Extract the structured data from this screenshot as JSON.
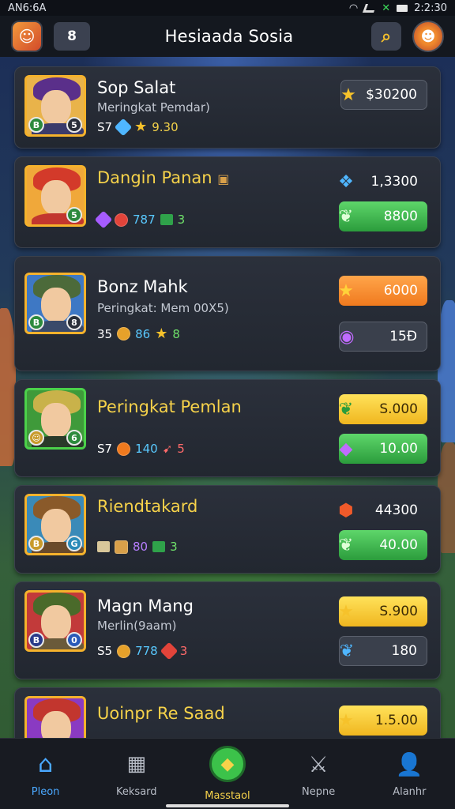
{
  "status": {
    "left": "AN6:6A",
    "time": "2:2:30"
  },
  "header": {
    "box_label": "8",
    "title": "Hesiaada Sosia"
  },
  "rows": [
    {
      "name": "Sop Salat",
      "subtitle": "Meringkat Pemdar)",
      "stats": [
        "S7",
        "9.30"
      ],
      "price_top": "$30200"
    },
    {
      "name": "Dangin Panan",
      "subtitle": "",
      "stats": [
        "787",
        "3"
      ],
      "price_top": "1,3300",
      "price_mid": "8800"
    },
    {
      "name": "Bonz Mahk",
      "subtitle": "Peringkat: Mem 00X5)",
      "stats": [
        "35",
        "86",
        "8"
      ],
      "price_top": "6000",
      "price_mid": "15Ð"
    },
    {
      "name": "Peringkat Pemlan",
      "subtitle": "",
      "stats": [
        "S7",
        "140",
        "5"
      ],
      "price_top": "S.000",
      "price_mid": "10.00"
    },
    {
      "name": "Riendtakard",
      "subtitle": "",
      "stats": [
        "80",
        "3"
      ],
      "price_top": "44300",
      "price_mid": "40.00"
    },
    {
      "name": "Magn Mang",
      "subtitle": "Merlin(9aam)",
      "stats": [
        "S5",
        "778",
        "3"
      ],
      "price_top": "S.900",
      "price_mid": "180"
    },
    {
      "name": "Uoinpr Re Saad",
      "subtitle": "",
      "stats": [],
      "price_top": "1.5.00"
    }
  ],
  "nav": [
    {
      "label": "Pleon",
      "icon": "home-icon"
    },
    {
      "label": "Keksard",
      "icon": "grid-icon"
    },
    {
      "label": "Masstaol",
      "icon": "treasure-icon"
    },
    {
      "label": "Nepne",
      "icon": "crossed-swords-icon"
    },
    {
      "label": "Alanhr",
      "icon": "profile-icon"
    }
  ],
  "colors": {
    "accent_gold": "#f6d24a",
    "accent_green": "#3cc24a",
    "nav_blue": "#4aa8ff"
  }
}
